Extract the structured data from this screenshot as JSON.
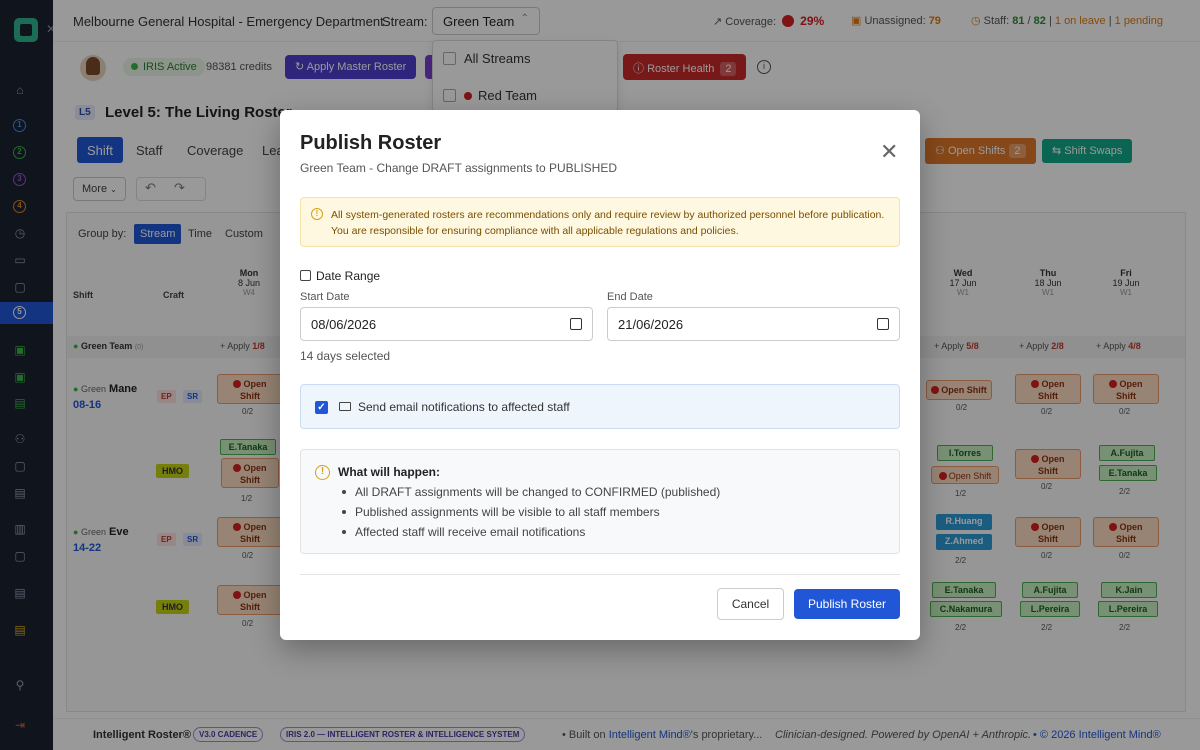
{
  "topbar": {
    "title": "Melbourne General Hospital - Emergency Department",
    "stream_label": "Stream:",
    "stream_value": "Green Team",
    "coverage_label": "Coverage:",
    "coverage_value": "29%",
    "unassigned_label": "Unassigned:",
    "unassigned_value": "79",
    "staff_label": "Staff:",
    "staff_current": "81",
    "staff_sep": "/",
    "staff_total": "82",
    "staff_leave": "1 on leave",
    "staff_pending": "1 pending"
  },
  "toolbar": {
    "iris_status": "IRIS Active",
    "credits": "98381 credits",
    "apply_master": "Apply Master Roster",
    "roster_health": "Roster Health",
    "roster_health_count": "2"
  },
  "level": {
    "badge": "L5",
    "title": "Level 5: The Living Roster"
  },
  "tabs": [
    "Shift",
    "Staff",
    "Coverage",
    "Lea"
  ],
  "actions": {
    "open_shifts": "Open Shifts",
    "open_shifts_count": "2",
    "shift_swaps": "Shift Swaps",
    "more": "More"
  },
  "groupby": {
    "label": "Group by:",
    "options": [
      "Stream",
      "Time",
      "Custom"
    ]
  },
  "grid": {
    "hdr_shift": "Shift",
    "hdr_craft": "Craft",
    "days": [
      {
        "name": "Mon",
        "date": "8 Jun",
        "week": "W4"
      },
      {
        "name": "Wed",
        "date": "17 Jun",
        "week": "W1"
      },
      {
        "name": "Thu",
        "date": "18 Jun",
        "week": "W1"
      },
      {
        "name": "Fri",
        "date": "19 Jun",
        "week": "W1"
      }
    ],
    "team": "Green Team",
    "team_count": "(0)",
    "apply_label": "+ Apply",
    "apply_counts": [
      "1/8",
      "5/8",
      "2/8",
      "4/8"
    ],
    "shifts": [
      {
        "stream": "Green",
        "name": "Mane",
        "time": "08-16"
      },
      {
        "stream": "Green",
        "name": "Eve",
        "time": "14-22"
      }
    ],
    "crafts": [
      "EP",
      "SR",
      "HMO"
    ],
    "open_label_1": "Open",
    "open_label_2": "Shift",
    "open_label_inline": "Open Shift",
    "names": [
      "E.Tanaka",
      "I.Torres",
      "A.Fujita",
      "E.Tanaka",
      "R.Huang",
      "Z.Ahmed",
      "E.Tanaka",
      "A.Fujita",
      "K.Jain",
      "C.Nakamura",
      "L.Pereira",
      "L.Pereira"
    ],
    "fractions": {
      "zero": "0/2",
      "one": "1/2",
      "two": "2/2"
    }
  },
  "dropdown": {
    "all_streams": "All Streams",
    "red_team": "Red Team"
  },
  "modal": {
    "title": "Publish Roster",
    "subtitle": "Green Team - Change DRAFT assignments to PUBLISHED",
    "warning": "All system-generated rosters are recommendations only and require review by authorized personnel before publication. You are responsible for ensuring compliance with all applicable regulations and policies.",
    "date_range_title": "Date Range",
    "start_label": "Start Date",
    "start_value": "08/06/2026",
    "end_label": "End Date",
    "end_value": "21/06/2026",
    "days_selected": "14 days selected",
    "notify_label": "Send email notifications to affected staff",
    "what_title": "What will happen:",
    "what_items": [
      "All DRAFT assignments will be changed to CONFIRMED (published)",
      "Published assignments will be visible to all staff members",
      "Affected staff will receive email notifications"
    ],
    "cancel": "Cancel",
    "publish": "Publish Roster"
  },
  "footer": {
    "brand": "Intelligent Roster®",
    "version": "V3.0 CADENCE",
    "iris": "IRIS 2.0 — INTELLIGENT ROSTER & INTELLIGENCE SYSTEM",
    "built_on": "Built on",
    "built_link": "Intelligent Mind®",
    "built_rest": "'s proprietary...",
    "clinician": "Clinician-designed. Powered by OpenAI + Anthropic.",
    "copyright": "© 2026 Intelligent Mind®"
  },
  "colors": {
    "primary": "#2157d6",
    "danger": "#d42020",
    "warning": "#e07a10",
    "success": "#2e8b32",
    "sidebar": "#1b2230"
  }
}
